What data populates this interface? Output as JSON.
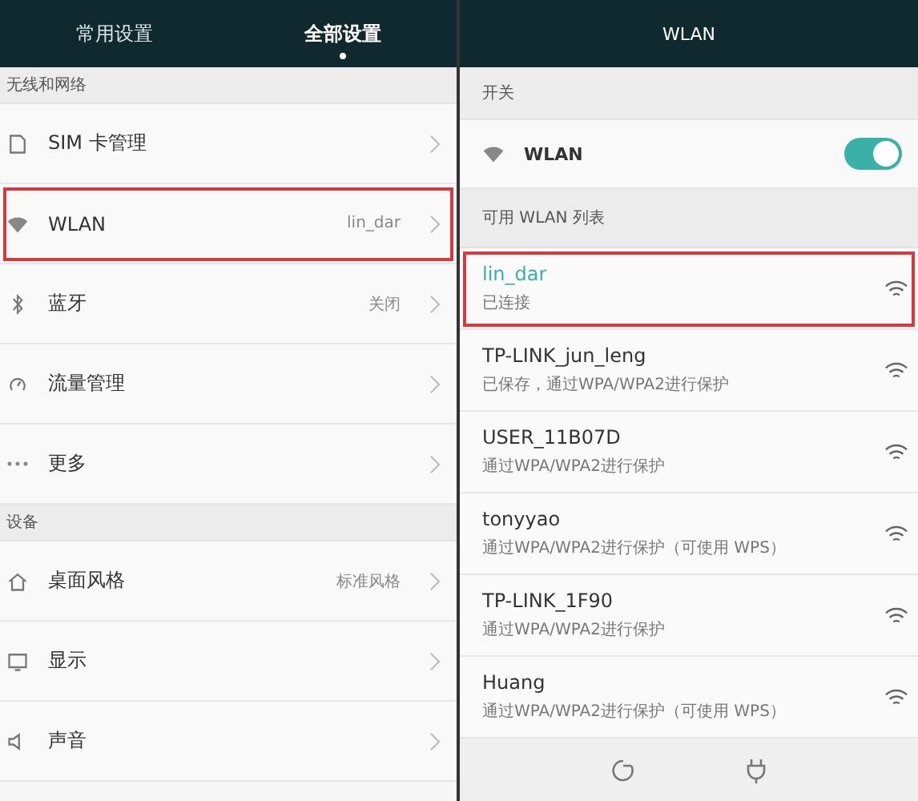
{
  "left_screen": {
    "tabs": [
      {
        "label": "常用设置",
        "selected": false
      },
      {
        "label": "全部设置",
        "selected": true
      }
    ],
    "sections": [
      {
        "title": "无线和网络",
        "items": [
          {
            "kind": "sim",
            "label": "SIM 卡管理",
            "highlighted": false
          },
          {
            "kind": "wifi",
            "label": "WLAN",
            "value": "lin_dar",
            "highlighted": true
          },
          {
            "kind": "bluetooth",
            "label": "蓝牙",
            "value": "关闭",
            "highlighted": false
          },
          {
            "kind": "gauge",
            "label": "流量管理",
            "highlighted": false
          },
          {
            "kind": "more",
            "label": "更多",
            "highlighted": false
          }
        ]
      },
      {
        "title": "设备",
        "items": [
          {
            "kind": "home",
            "label": "桌面风格",
            "value": "标准风格",
            "highlighted": false
          },
          {
            "kind": "display",
            "label": "显示",
            "highlighted": false
          },
          {
            "kind": "sound",
            "label": "声音",
            "highlighted": false
          }
        ]
      }
    ]
  },
  "right_screen": {
    "title": "WLAN",
    "switch_section": "开关",
    "wlan_switch": {
      "label": "WLAN",
      "on": true
    },
    "list_title": "可用 WLAN 列表",
    "networks": [
      {
        "name": "lin_dar",
        "status": "已连接",
        "connected": true,
        "highlighted": true
      },
      {
        "name": "TP-LINK_jun_leng",
        "status": "已保存，通过WPA/WPA2进行保护",
        "connected": false,
        "highlighted": false
      },
      {
        "name": "USER_11B07D",
        "status": "通过WPA/WPA2进行保护",
        "connected": false,
        "highlighted": false
      },
      {
        "name": "tonyyao",
        "status": "通过WPA/WPA2进行保护（可使用 WPS）",
        "connected": false,
        "highlighted": false
      },
      {
        "name": "TP-LINK_1F90",
        "status": "通过WPA/WPA2进行保护",
        "connected": false,
        "highlighted": false
      },
      {
        "name": "Huang",
        "status": "通过WPA/WPA2进行保护（可使用 WPS）",
        "connected": false,
        "highlighted": false
      }
    ]
  }
}
